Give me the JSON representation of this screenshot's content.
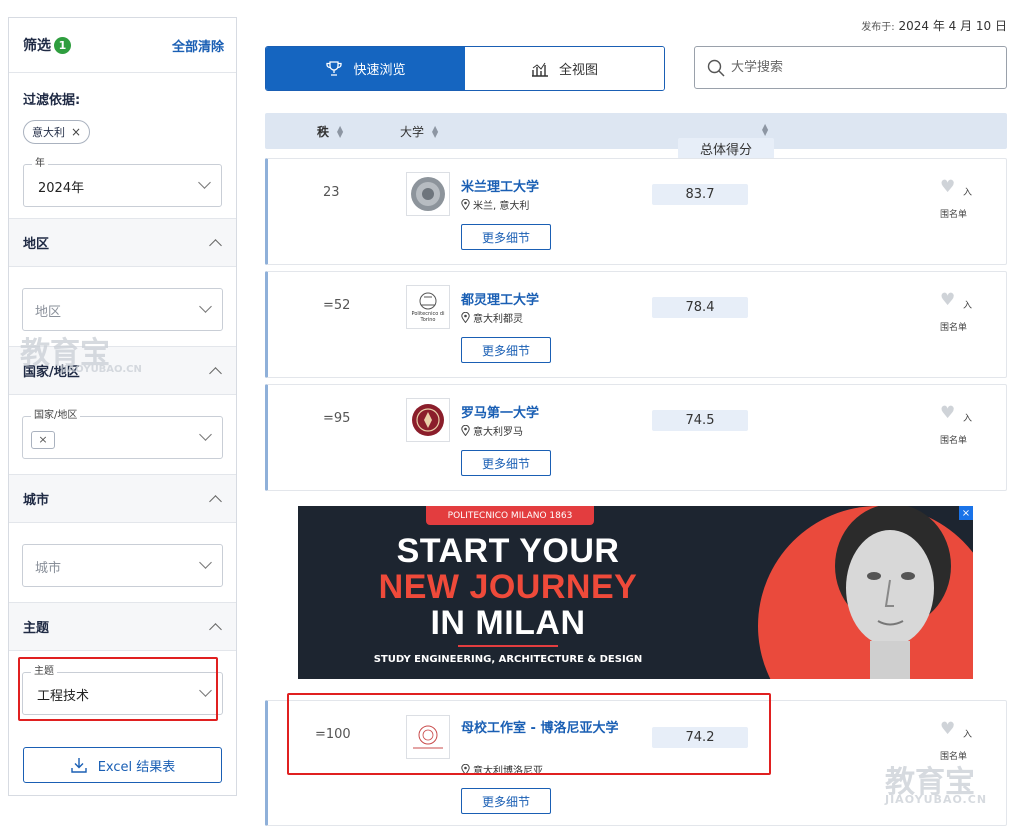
{
  "published": {
    "prefix": "发布于:",
    "date": "2024 年 4 月 10 日"
  },
  "sidebar": {
    "title": "筛选",
    "badge_count": "1",
    "clear_all": "全部清除",
    "filter_by_label": "过滤依据:",
    "active_chip": "意大利",
    "year": {
      "legend": "年",
      "value": "2024年"
    },
    "sections": [
      {
        "title": "地区",
        "placeholder": "地区"
      },
      {
        "title": "国家/地区",
        "legend": "国家/地区"
      },
      {
        "title": "城市",
        "placeholder": "城市"
      },
      {
        "title": "主题",
        "legend": "主题",
        "value": "工程技术"
      }
    ],
    "excel_button": "Excel 结果表"
  },
  "view_toggle": {
    "quick": "快速浏览",
    "full": "全视图"
  },
  "search": {
    "placeholder": "大学搜索"
  },
  "table_header": {
    "rank": "秩",
    "university": "大学",
    "score": "总体得分"
  },
  "rows": [
    {
      "rank": "23",
      "name": "米兰理工大学",
      "location": "米兰, 意大利",
      "score": "83.7",
      "more": "更多细节",
      "fav_in": "入",
      "fav_list": "围名单"
    },
    {
      "rank": "=52",
      "name": "都灵理工大学",
      "location": "意大利都灵",
      "score": "78.4",
      "more": "更多细节",
      "fav_in": "入",
      "fav_list": "围名单",
      "logo_text": "Politecnico di Torino"
    },
    {
      "rank": "=95",
      "name": "罗马第一大学",
      "location": "意大利罗马",
      "score": "74.5",
      "more": "更多细节",
      "fav_in": "入",
      "fav_list": "围名单"
    },
    {
      "rank": "=100",
      "name": "母校工作室 - 博洛尼亚大学",
      "location": "意大利博洛尼亚",
      "score": "74.2",
      "more": "更多细节",
      "fav_in": "入",
      "fav_list": "围名单"
    }
  ],
  "ad": {
    "tag": "POLITECNICO MILANO 1863",
    "line1": "START YOUR",
    "line2": "NEW JOURNEY",
    "line3": "IN MILAN",
    "sub": "STUDY ENGINEERING, ARCHITECTURE & DESIGN",
    "close": "×"
  },
  "watermarks": {
    "cn": "教育宝",
    "en": "JIAOYUBAO.CN"
  },
  "colors": {
    "accent": "#1a5fb4",
    "active_toggle": "#1565c0",
    "highlight_box": "#e02020",
    "ad_red": "#e33d3f"
  }
}
